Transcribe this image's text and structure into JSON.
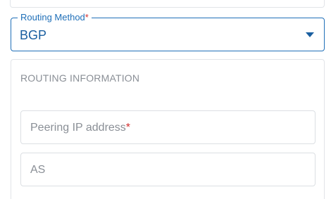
{
  "routing_method": {
    "label": "Routing Method",
    "required_mark": "*",
    "value": "BGP"
  },
  "routing_information": {
    "title": "ROUTING INFORMATION",
    "peering_ip": {
      "placeholder": "Peering IP address",
      "required_mark": "*"
    },
    "as": {
      "placeholder": "AS"
    }
  },
  "icons": {
    "select_caret": "caret-down-icon"
  },
  "colors": {
    "accent": "#1f6fb8",
    "required": "#d32f2f",
    "muted_text": "#8a8f96",
    "border": "#dcdfe3"
  }
}
